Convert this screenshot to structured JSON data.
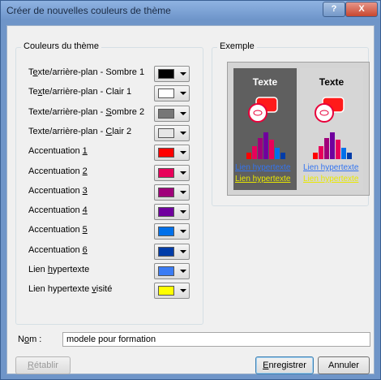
{
  "window": {
    "title": "Créer de nouvelles couleurs de thème",
    "help_label": "?",
    "close_label": "X"
  },
  "theme_colors": {
    "group_title": "Couleurs du thème",
    "rows": [
      {
        "label_pre": "T",
        "label_u": "e",
        "label_post": "xte/arrière-plan - Sombre 1",
        "color": "#000000"
      },
      {
        "label_pre": "Te",
        "label_u": "x",
        "label_post": "te/arrière-plan - Clair 1",
        "color": "#ffffff"
      },
      {
        "label_pre": "Texte/arrière-plan - ",
        "label_u": "S",
        "label_post": "ombre 2",
        "color": "#777777"
      },
      {
        "label_pre": "Texte/arrière-plan - ",
        "label_u": "C",
        "label_post": "lair 2",
        "color": "#e6e6e6"
      },
      {
        "label_pre": "Accentuation ",
        "label_u": "1",
        "label_post": "",
        "color": "#ff0000"
      },
      {
        "label_pre": "Accentuation ",
        "label_u": "2",
        "label_post": "",
        "color": "#e8005a"
      },
      {
        "label_pre": "Accentuation ",
        "label_u": "3",
        "label_post": "",
        "color": "#a0007a"
      },
      {
        "label_pre": "Accentuation ",
        "label_u": "4",
        "label_post": "",
        "color": "#70009e"
      },
      {
        "label_pre": "Accentuation ",
        "label_u": "5",
        "label_post": "",
        "color": "#0070ea"
      },
      {
        "label_pre": "Accentuation ",
        "label_u": "6",
        "label_post": "",
        "color": "#003ca8"
      },
      {
        "label_pre": "Lien ",
        "label_u": "h",
        "label_post": "ypertexte",
        "color": "#3b7cf4"
      },
      {
        "label_pre": "Lien hypertexte ",
        "label_u": "v",
        "label_post": "isité",
        "color": "#ffff00"
      }
    ]
  },
  "example": {
    "group_title": "Exemple",
    "text_label": "Texte",
    "link_label": "Lien hypertexte",
    "visited_link_label": "Lien hypertexte"
  },
  "name": {
    "label_pre": "N",
    "label_u": "o",
    "label_post": "m :",
    "value": "modele pour formation"
  },
  "buttons": {
    "reset": {
      "label_pre": "",
      "label_u": "R",
      "label_post": "établir"
    },
    "save": {
      "label_pre": "",
      "label_u": "E",
      "label_post": "nregistrer"
    },
    "cancel": {
      "label": "Annuler"
    }
  }
}
